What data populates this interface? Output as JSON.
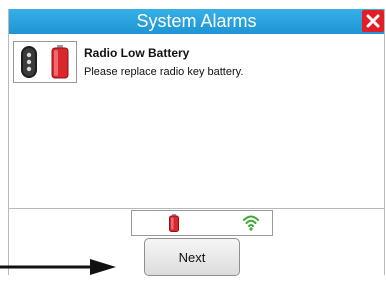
{
  "dialog": {
    "title": "System Alarms",
    "close_icon": "close-icon",
    "colors": {
      "titlebar": "#22a1dc",
      "close_button": "#e21f26",
      "battery_red": "#d9272e",
      "signal_green": "#3aa935"
    }
  },
  "alarms": [
    {
      "title": "Radio Low Battery",
      "message": "Please replace radio key battery.",
      "icons": [
        "radio-key-icon",
        "battery-icon"
      ]
    }
  ],
  "status": {
    "icons": [
      "battery-low-icon",
      "wifi-signal-icon"
    ]
  },
  "footer": {
    "next_label": "Next",
    "pointer_icon": "arrow-right-icon"
  }
}
